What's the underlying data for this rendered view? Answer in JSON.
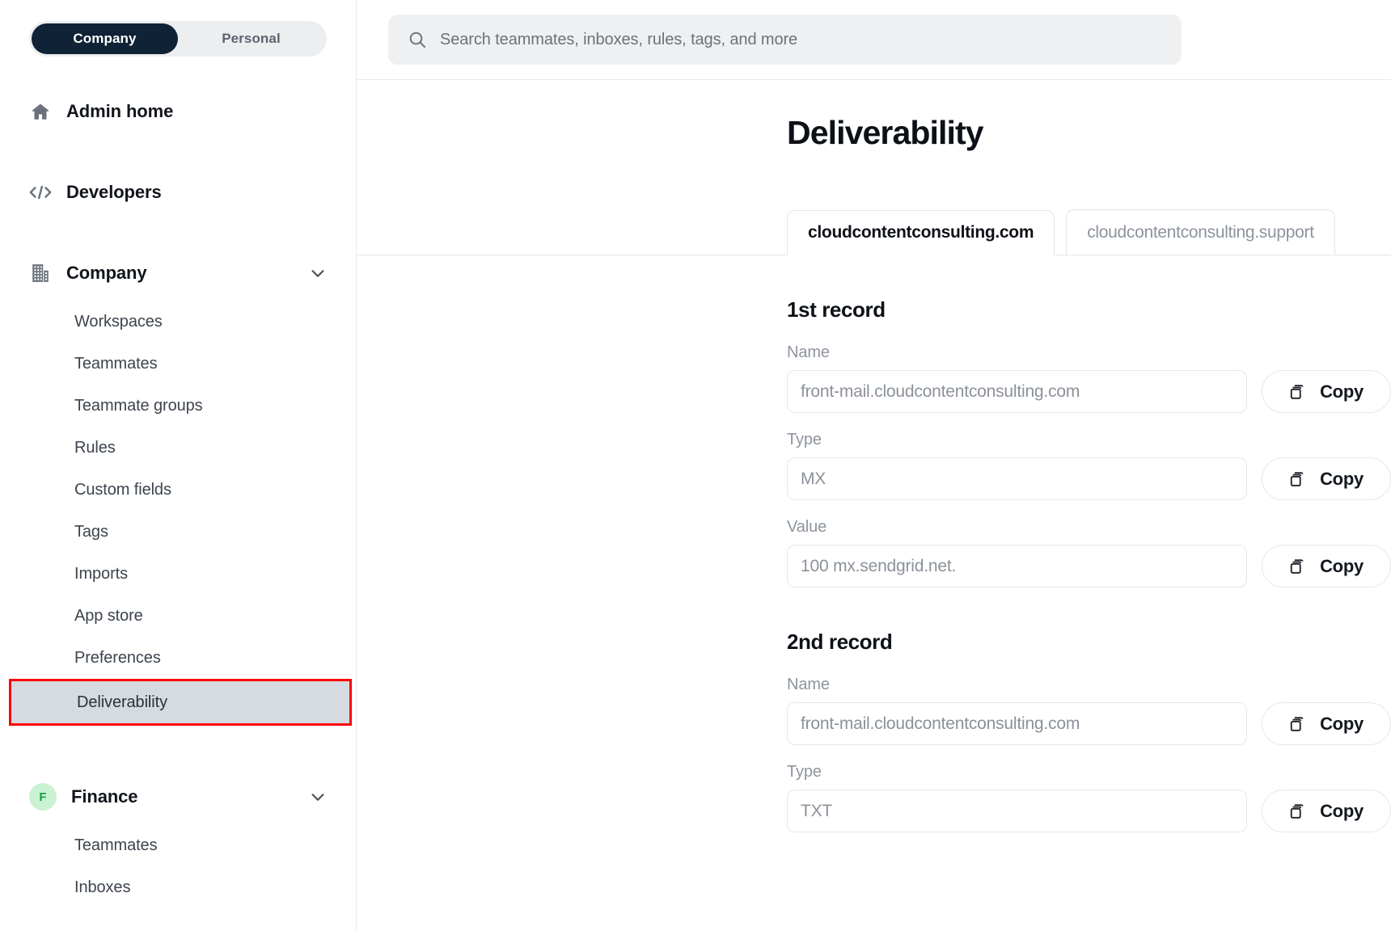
{
  "sidebar": {
    "segmented": {
      "active": "Company",
      "inactive": "Personal"
    },
    "admin_home": {
      "label": "Admin home",
      "icon": "home-icon"
    },
    "developers": {
      "label": "Developers",
      "icon": "code-icon"
    },
    "company_group": {
      "label": "Company",
      "icon": "building-icon",
      "chevron": "chevron-down-icon",
      "items": [
        {
          "label": "Workspaces"
        },
        {
          "label": "Teammates"
        },
        {
          "label": "Teammate groups"
        },
        {
          "label": "Rules"
        },
        {
          "label": "Custom fields"
        },
        {
          "label": "Tags"
        },
        {
          "label": "Imports"
        },
        {
          "label": "App store"
        },
        {
          "label": "Preferences"
        },
        {
          "label": "Deliverability"
        }
      ],
      "selected_item": "Deliverability"
    },
    "finance_group": {
      "label": "Finance",
      "avatar_initial": "F",
      "chevron": "chevron-down-icon",
      "items": [
        {
          "label": "Teammates"
        },
        {
          "label": "Inboxes"
        }
      ]
    }
  },
  "topbar": {
    "search": {
      "icon": "search-icon",
      "placeholder": "Search teammates, inboxes, rules, tags, and more",
      "value": ""
    }
  },
  "main": {
    "title": "Deliverability",
    "tabs": [
      {
        "label": "cloudcontentconsulting.com",
        "active": true
      },
      {
        "label": "cloudcontentconsulting.support",
        "active": false
      }
    ],
    "records": [
      {
        "title": "1st record",
        "fields": [
          {
            "label": "Name",
            "value": "front-mail.cloudcontentconsulting.com",
            "copy_label": "Copy",
            "copy_icon": "copy-icon"
          },
          {
            "label": "Type",
            "value": "MX",
            "copy_label": "Copy",
            "copy_icon": "copy-icon"
          },
          {
            "label": "Value",
            "value": "100 mx.sendgrid.net.",
            "copy_label": "Copy",
            "copy_icon": "copy-icon"
          }
        ]
      },
      {
        "title": "2nd record",
        "fields": [
          {
            "label": "Name",
            "value": "front-mail.cloudcontentconsulting.com",
            "copy_label": "Copy",
            "copy_icon": "copy-icon"
          },
          {
            "label": "Type",
            "value": "TXT",
            "copy_label": "Copy",
            "copy_icon": "copy-icon"
          }
        ]
      }
    ]
  },
  "colors": {
    "segmented_active_bg": "#0f2236",
    "selected_item_bg": "#d6dae1",
    "highlight_border": "#ff0000",
    "finance_avatar_bg": "#c9f2d2",
    "finance_avatar_fg": "#15a03d",
    "search_bg": "#eff0f2"
  }
}
